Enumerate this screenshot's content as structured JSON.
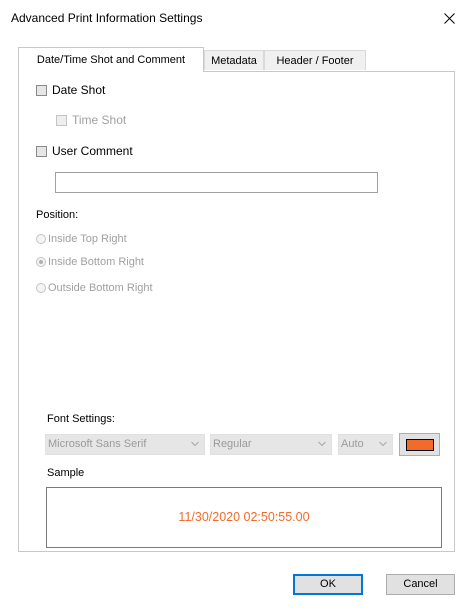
{
  "window": {
    "title": "Advanced Print Information Settings"
  },
  "tabs": [
    {
      "label": "Date/Time Shot and Comment",
      "active": true
    },
    {
      "label": "Metadata",
      "active": false
    },
    {
      "label": "Header / Footer",
      "active": false
    }
  ],
  "options": {
    "date_shot": "Date Shot",
    "time_shot": "Time Shot",
    "user_comment": "User Comment",
    "comment_value": ""
  },
  "position": {
    "label": "Position:",
    "options": [
      {
        "label": "Inside Top Right",
        "selected": false
      },
      {
        "label": "Inside Bottom Right",
        "selected": true
      },
      {
        "label": "Outside Bottom Right",
        "selected": false
      }
    ]
  },
  "font": {
    "label": "Font Settings:",
    "family": "Microsoft Sans Serif",
    "style": "Regular",
    "size": "Auto",
    "color": "#f26b2a"
  },
  "sample": {
    "label": "Sample",
    "text": "11/30/2020 02:50:55.00",
    "color": "#f26b2a"
  },
  "buttons": {
    "ok": "OK",
    "cancel": "Cancel"
  },
  "icons": {
    "close": "close-icon",
    "dropdown": "chevron-down-icon"
  }
}
